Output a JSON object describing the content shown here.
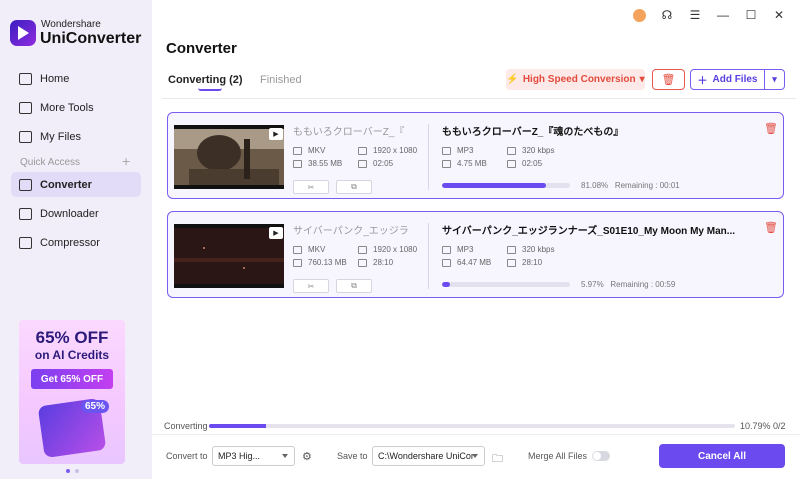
{
  "app": {
    "brand_small": "Wondershare",
    "brand_big": "UniConverter"
  },
  "colors": {
    "accent": "#6b4bf0",
    "danger": "#e24b3d"
  },
  "sidebar": {
    "items": [
      {
        "label": "Home",
        "icon": "home-icon"
      },
      {
        "label": "More Tools",
        "icon": "tools-icon"
      },
      {
        "label": "My Files",
        "icon": "files-icon"
      }
    ],
    "quick_access_label": "Quick Access",
    "quick_items": [
      {
        "label": "Converter",
        "icon": "converter-icon",
        "active": true
      },
      {
        "label": "Downloader",
        "icon": "downloader-icon"
      },
      {
        "label": "Compressor",
        "icon": "compressor-icon"
      }
    ],
    "promo": {
      "line1": "65% OFF",
      "line2": "on AI Credits",
      "button": "Get 65% OFF",
      "badge": "65%"
    }
  },
  "header": {
    "title": "Converter",
    "tab_converting": "Converting (2)",
    "tab_finished": "Finished",
    "high_speed": "High Speed Conversion",
    "add_files": "Add Files"
  },
  "tasks": [
    {
      "src_name": "ももいろクローバーZ_『",
      "src_format": "MKV",
      "src_resolution": "1920 x 1080",
      "src_size": "38.55 MB",
      "src_duration": "02:05",
      "dst_name": "ももいろクローバーZ_『魂のたべもの』",
      "dst_format": "MP3",
      "dst_bitrate": "320 kbps",
      "dst_size": "4.75 MB",
      "dst_duration": "02:05",
      "progress": 81.08,
      "percent": "81.08%",
      "remaining": "Remaining : 00:01"
    },
    {
      "src_name": "サイバーパンク_エッジラ",
      "src_format": "MKV",
      "src_resolution": "1920 x 1080",
      "src_size": "760.13 MB",
      "src_duration": "28:10",
      "dst_name": "サイバーパンク_エッジランナーズ_S01E10_My Moon My Man...",
      "dst_format": "MP3",
      "dst_bitrate": "320 kbps",
      "dst_size": "64.47 MB",
      "dst_duration": "28:10",
      "progress": 5.97,
      "percent": "5.97%",
      "remaining": "Remaining : 00:59"
    }
  ],
  "footer": {
    "converting_label": "Converting",
    "overall_progress": 10.79,
    "overall_text": "10.79%  0/2",
    "convert_to_label": "Convert to",
    "convert_to_value": "MP3 Hig...",
    "save_to_label": "Save to",
    "save_to_value": "C:\\Wondershare UniCor",
    "merge_label": "Merge All Files",
    "cancel_all": "Cancel All"
  }
}
